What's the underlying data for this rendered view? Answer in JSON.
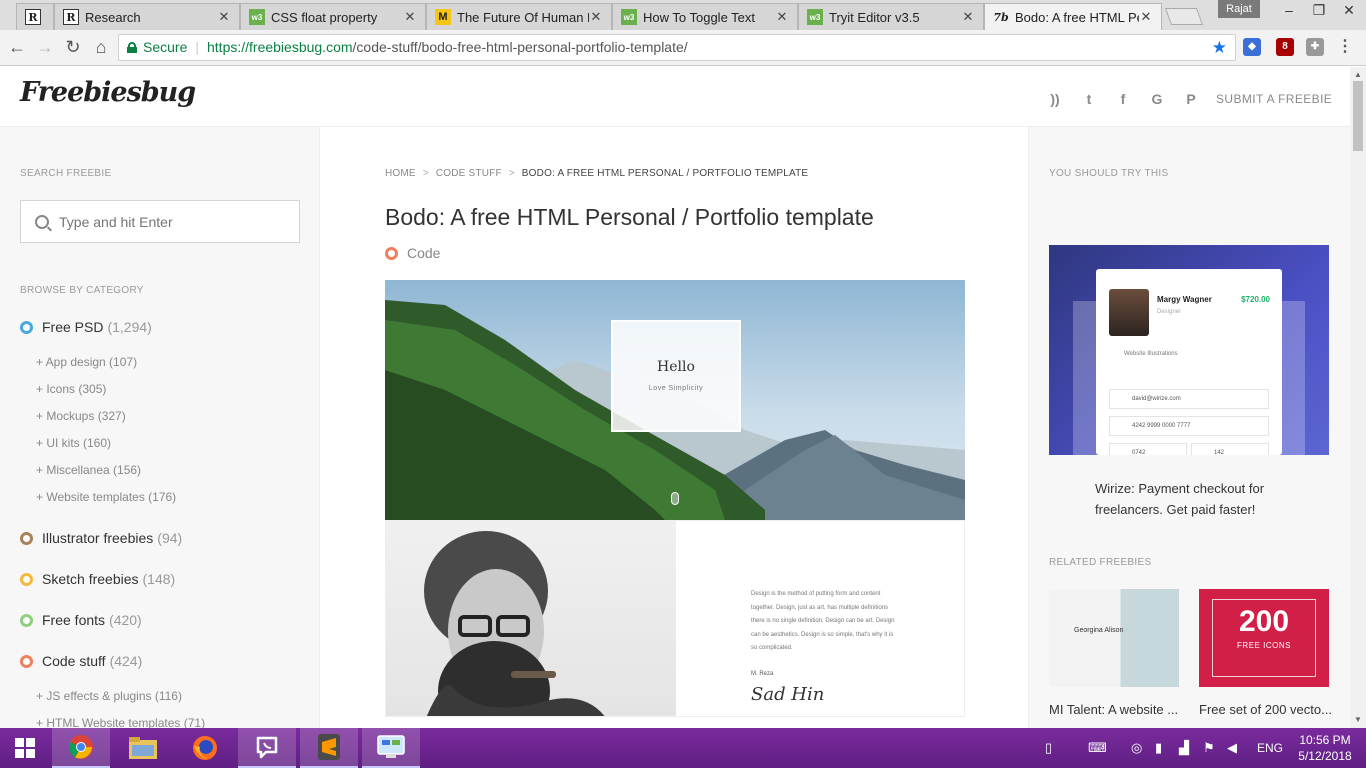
{
  "browser": {
    "tabs": [
      {
        "favicon": "R",
        "title": ""
      },
      {
        "favicon": "R",
        "title": "Research"
      },
      {
        "favicon": "w3",
        "title": "CSS float property"
      },
      {
        "favicon": "M",
        "title": "The Future Of Human E"
      },
      {
        "favicon": "w3",
        "title": "How To Toggle Text"
      },
      {
        "favicon": "w3",
        "title": "Tryit Editor v3.5"
      },
      {
        "favicon": "7b",
        "title": "Bodo: A free HTML Pers"
      }
    ],
    "profile_name": "Rajat",
    "secure_label": "Secure",
    "url_host": "https://freebiesbug.com",
    "url_path": "/code-stuff/bodo-free-html-personal-portfolio-template/",
    "extension_badge": "8"
  },
  "header": {
    "logo": "Freebiesbug",
    "submit_label": "SUBMIT A FREEBIE"
  },
  "sidebar": {
    "search_label": "SEARCH FREEBIE",
    "search_placeholder": "Type and hit Enter",
    "browse_label": "BROWSE BY CATEGORY",
    "categories": [
      {
        "name": "Free PSD",
        "count": "(1,294)",
        "color": "#4aa8e0"
      },
      {
        "name": "Illustrator freebies",
        "count": "(94)",
        "color": "#a9825a"
      },
      {
        "name": "Sketch freebies",
        "count": "(148)",
        "color": "#f3b93c"
      },
      {
        "name": "Free fonts",
        "count": "(420)",
        "color": "#8fd07e"
      },
      {
        "name": "Code stuff",
        "count": "(424)",
        "color": "#f07f5e"
      }
    ],
    "psd_sub": [
      "+ App design (107)",
      "+ Icons (305)",
      "+ Mockups (327)",
      "+ UI kits (160)",
      "+ Miscellanea (156)",
      "+ Website templates (176)"
    ],
    "code_sub": [
      "+ JS effects & plugins (116)",
      "+ HTML Website templates (71)"
    ]
  },
  "post": {
    "crumb_home": "HOME",
    "crumb_cat": "CODE STUFF",
    "crumb_current": "BODO: A FREE HTML PERSONAL / PORTFOLIO TEMPLATE",
    "title": "Bodo: A free HTML Personal / Portfolio template",
    "tag": "Code",
    "hero_heading": "Hello",
    "hero_sub": "Love Simplicity",
    "preview_text": "Design is the method of putting form and content together. Design, just as art, has multiple definitions there is no single definition. Design can be art. Design can be aesthetics. Design is so simple, that's why it is so complicated.",
    "preview_name": "M. Reza",
    "preview_signature": "Sad Hin"
  },
  "aside": {
    "try_label": "YOU SHOULD TRY THIS",
    "ad_name": "Margy Wagner",
    "ad_role": "Designer",
    "ad_price": "$720.00",
    "ad_item": "Website Illustrations",
    "ad_email": "david@wirize.com",
    "ad_phone": "4242 9999 0000 7777",
    "ad_f1": "0742",
    "ad_f2": "142",
    "ad_caption": "Wirize: Payment checkout for freelancers. Get paid faster!",
    "related_label": "RELATED FREEBIES",
    "related": [
      {
        "title": "MI Talent: A website ...",
        "thumb_text": "Georgina Alison"
      },
      {
        "title": "Free set of 200 vecto...",
        "thumb_num": "200",
        "thumb_text": "FREE ICONS"
      }
    ]
  },
  "taskbar": {
    "lang": "ENG",
    "time": "10:56 PM",
    "date": "5/12/2018"
  }
}
